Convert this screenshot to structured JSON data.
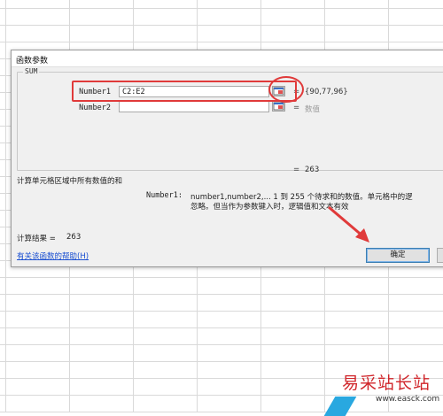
{
  "dialog": {
    "title": "函数参数",
    "function_name": "SUM",
    "args": [
      {
        "label": "Number1",
        "value": "C2:E2",
        "eq": "=",
        "result": "{90,77,96}"
      },
      {
        "label": "Number2",
        "value": "",
        "eq": "=",
        "result": "数值"
      }
    ],
    "total_eq": "=",
    "total_value": "263",
    "description": "计算单元格区域中所有数值的和",
    "arg_help_label": "Number1:",
    "arg_help_line1": "number1,number2,... 1 到 255 个待求和的数值。单元格中的逻",
    "arg_help_line2": "忽略。但当作为参数键入时，逻辑值和文本有效",
    "result_label": "计算结果 =",
    "result_value": "263",
    "help_link": "有关该函数的帮助(H)",
    "ok_label": "确定",
    "cancel_label": ""
  },
  "watermark": {
    "main": "易采站长站",
    "sub": "www.easck.com"
  },
  "colors": {
    "annotation": "#e03a3a",
    "link": "#1a4fd1",
    "watermark_red": "#d0262b",
    "watermark_blue": "#29a8e0"
  },
  "icons": [
    "range-select-icon",
    "annotation-arrow-icon"
  ]
}
